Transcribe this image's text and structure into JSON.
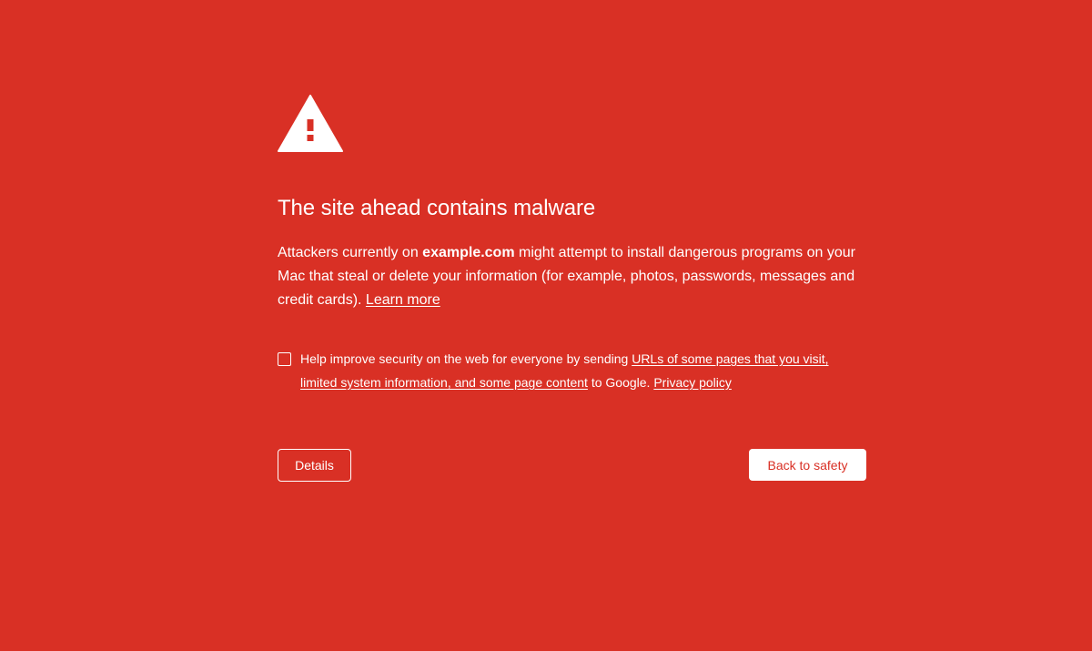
{
  "icon": "warning-triangle-icon",
  "colors": {
    "background": "#d93025",
    "foreground": "#ffffff",
    "button_text": "#d93025"
  },
  "heading": "The site ahead contains malware",
  "message": {
    "prefix": "Attackers currently on ",
    "domain": "example.com",
    "suffix": " might attempt to install dangerous programs on your Mac that steal or delete your information (for example, photos, passwords, messages and credit cards). ",
    "learn_more": "Learn more"
  },
  "optin": {
    "checked": false,
    "prefix": "Help improve security on the web for everyone by sending ",
    "link": "URLs of some pages that you visit, limited system information, and some page content",
    "middle": " to Google. ",
    "privacy_link": "Privacy policy"
  },
  "buttons": {
    "details": "Details",
    "back_to_safety": "Back to safety"
  }
}
